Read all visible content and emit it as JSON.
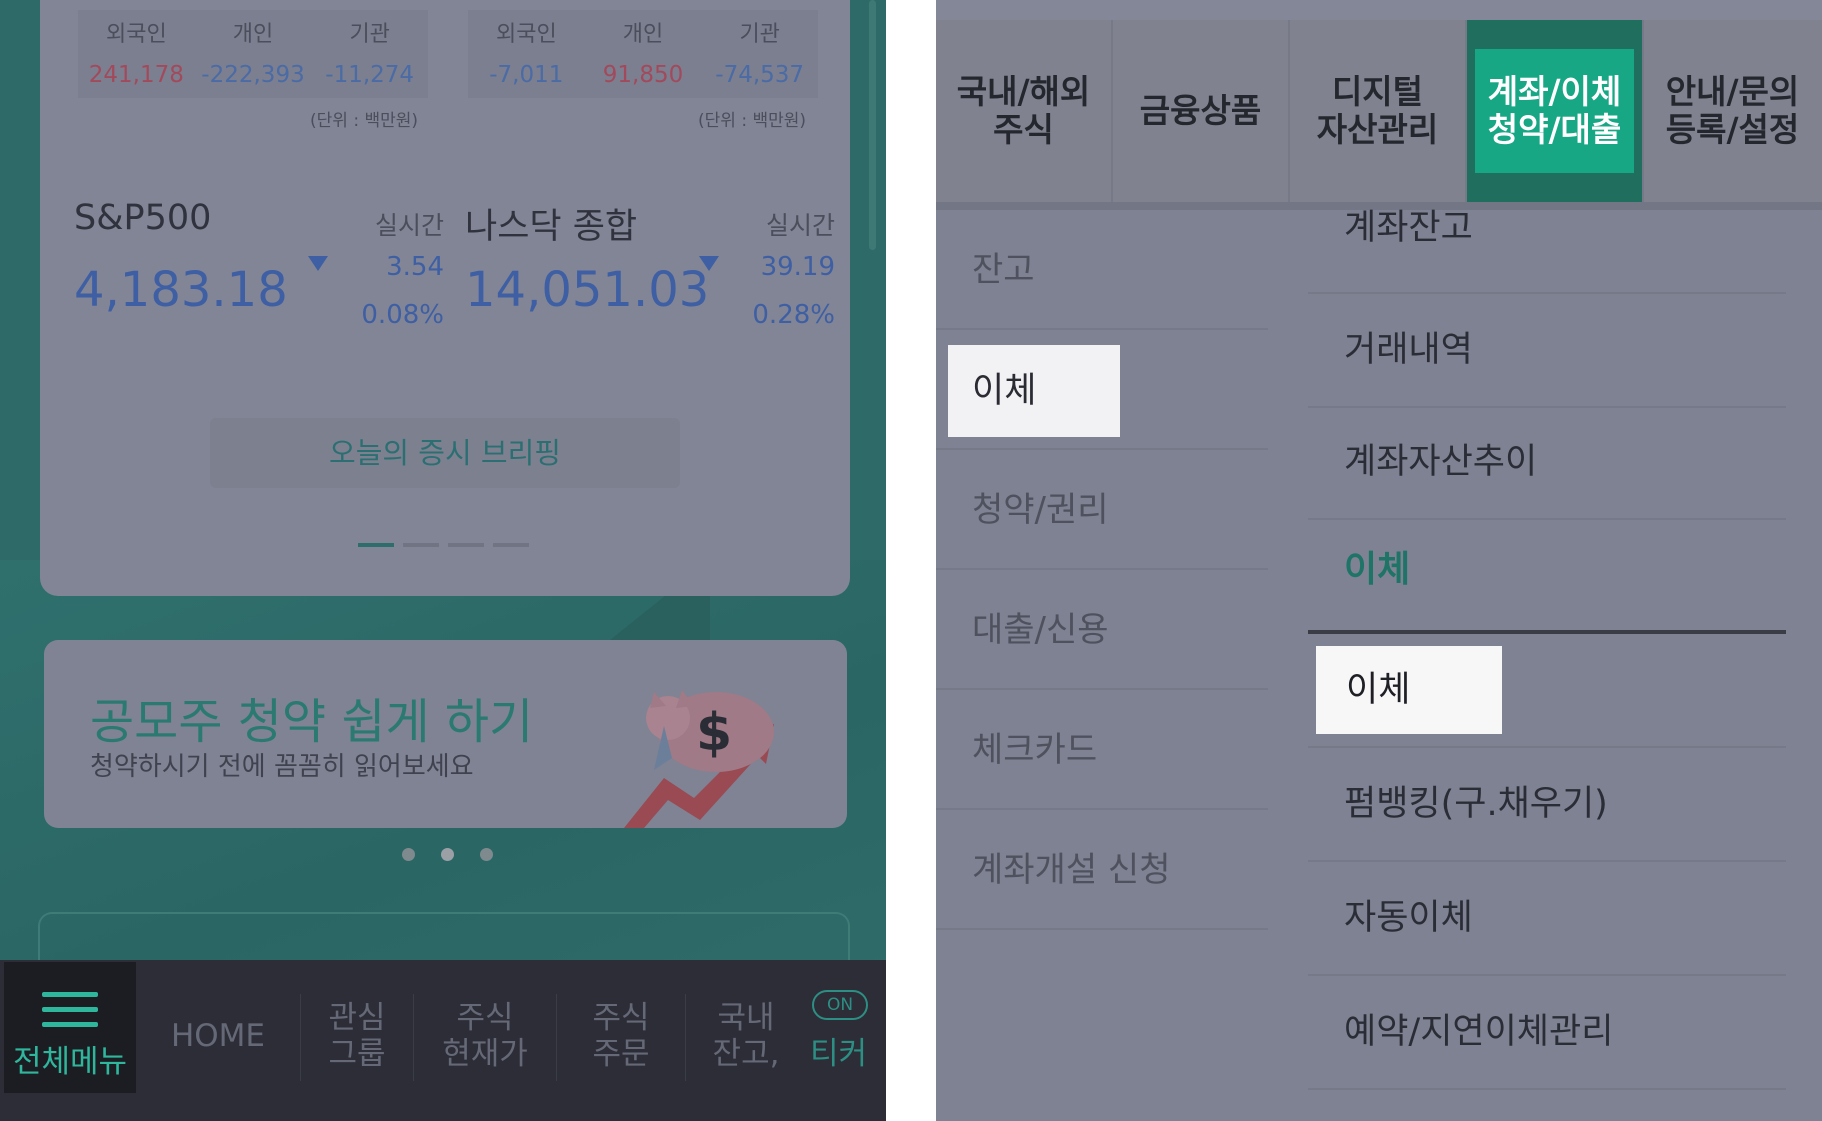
{
  "left_screen": {
    "investor_flow": [
      {
        "headers": [
          "외국인",
          "개인",
          "기관"
        ],
        "values": [
          "241,178",
          "-222,393",
          "-11,274"
        ],
        "value_colors": [
          "red",
          "blue",
          "blue"
        ],
        "unit": "(단위 : 백만원)"
      },
      {
        "headers": [
          "외국인",
          "개인",
          "기관"
        ],
        "values": [
          "-7,011",
          "91,850",
          "-74,537"
        ],
        "value_colors": [
          "blue",
          "red",
          "blue"
        ],
        "unit": "(단위 : 백만원)"
      }
    ],
    "indices": [
      {
        "name": "S&P500",
        "realtime": "실시간",
        "value": "4,183.18",
        "change": "3.54",
        "change_pct": "0.08%",
        "direction": "down"
      },
      {
        "name": "나스닥 종합",
        "realtime": "실시간",
        "value": "14,051.03",
        "change": "39.19",
        "change_pct": "0.28%",
        "direction": "down"
      }
    ],
    "briefing_button": "오늘의 증시 브리핑",
    "banner": {
      "title": "공모주 청약 쉽게 하기",
      "subtitle": "청약하시기 전에 꼼꼼히 읽어보세요",
      "illustration_icon": "piggy-bank-dollar-icon"
    },
    "tabbar": {
      "menu_label": "전체메뉴",
      "home": "HOME",
      "watch_group": [
        "관심",
        "그룹"
      ],
      "stock_price": [
        "주식",
        "현재가"
      ],
      "stock_order": [
        "주식",
        "주문"
      ],
      "domestic_balance": [
        "국내",
        "잔고,"
      ],
      "ticker_badge": "ON",
      "ticker": "티커"
    }
  },
  "right_screen": {
    "top_nav": [
      {
        "line1": "국내/해외",
        "line2": "주식",
        "active": false
      },
      {
        "line1": "금융상품",
        "line2": "",
        "active": false
      },
      {
        "line1": "디지털",
        "line2": "자산관리",
        "active": false
      },
      {
        "line1": "계좌/이체",
        "line2": "청약/대출",
        "active": true
      },
      {
        "line1": "안내/문의",
        "line2": "등록/설정",
        "active": false
      }
    ],
    "categories": [
      "잔고",
      "이체",
      "청약/권리",
      "대출/신용",
      "체크카드",
      "계좌개설 신청"
    ],
    "selected_category": "이체",
    "submenu_top": [
      "계좌잔고",
      "거래내역",
      "계좌자산추이"
    ],
    "submenu_section": "이체",
    "submenu_selected": "이체",
    "submenu_bottom": [
      "펌뱅킹(구.채우기)",
      "자동이체",
      "예약/지연이체관리"
    ]
  },
  "colors": {
    "accent_green": "#17a784",
    "up_red": "#a24a5c",
    "down_blue": "#3e5fa3"
  }
}
